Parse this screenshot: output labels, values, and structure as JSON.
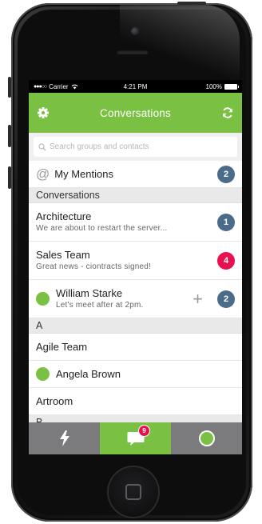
{
  "status_bar": {
    "carrier": "Carrier",
    "time": "4:21 PM",
    "battery": "100%"
  },
  "header": {
    "title": "Conversations",
    "left_icon": "gear-icon",
    "right_icon": "refresh-icon"
  },
  "search": {
    "placeholder": "Search groups and contacts"
  },
  "mentions": {
    "label": "My Mentions",
    "count": "2"
  },
  "conversations": {
    "section_title": "Conversations",
    "items": [
      {
        "name": "Architecture",
        "preview": "We are about to restart the server...",
        "count": "1",
        "badge_color": "#4a6c8a"
      },
      {
        "name": "Sales Team",
        "preview": "Great news - ciontracts signed!",
        "count": "4",
        "badge_color": "#e8104f"
      },
      {
        "name": "William Starke",
        "preview": "Let's meet after at 2pm.",
        "count": "2",
        "badge_color": "#4a6c8a"
      }
    ]
  },
  "contacts": {
    "section_a": "A",
    "items": [
      {
        "name": "Agile Team",
        "presence": false
      },
      {
        "name": "Angela Brown",
        "presence": true
      },
      {
        "name": "Artroom",
        "presence": false
      }
    ],
    "section_b": "B"
  },
  "tabbar": {
    "tabs": [
      {
        "icon": "bolt-icon",
        "active": false
      },
      {
        "icon": "chat-icon",
        "active": true,
        "badge": "9"
      },
      {
        "icon": "status-icon",
        "active": false
      }
    ]
  },
  "colors": {
    "accent": "#7ac143",
    "badge_blue": "#4a6c8a",
    "badge_red": "#e8104f",
    "tabbar": "#7b7b7d"
  }
}
